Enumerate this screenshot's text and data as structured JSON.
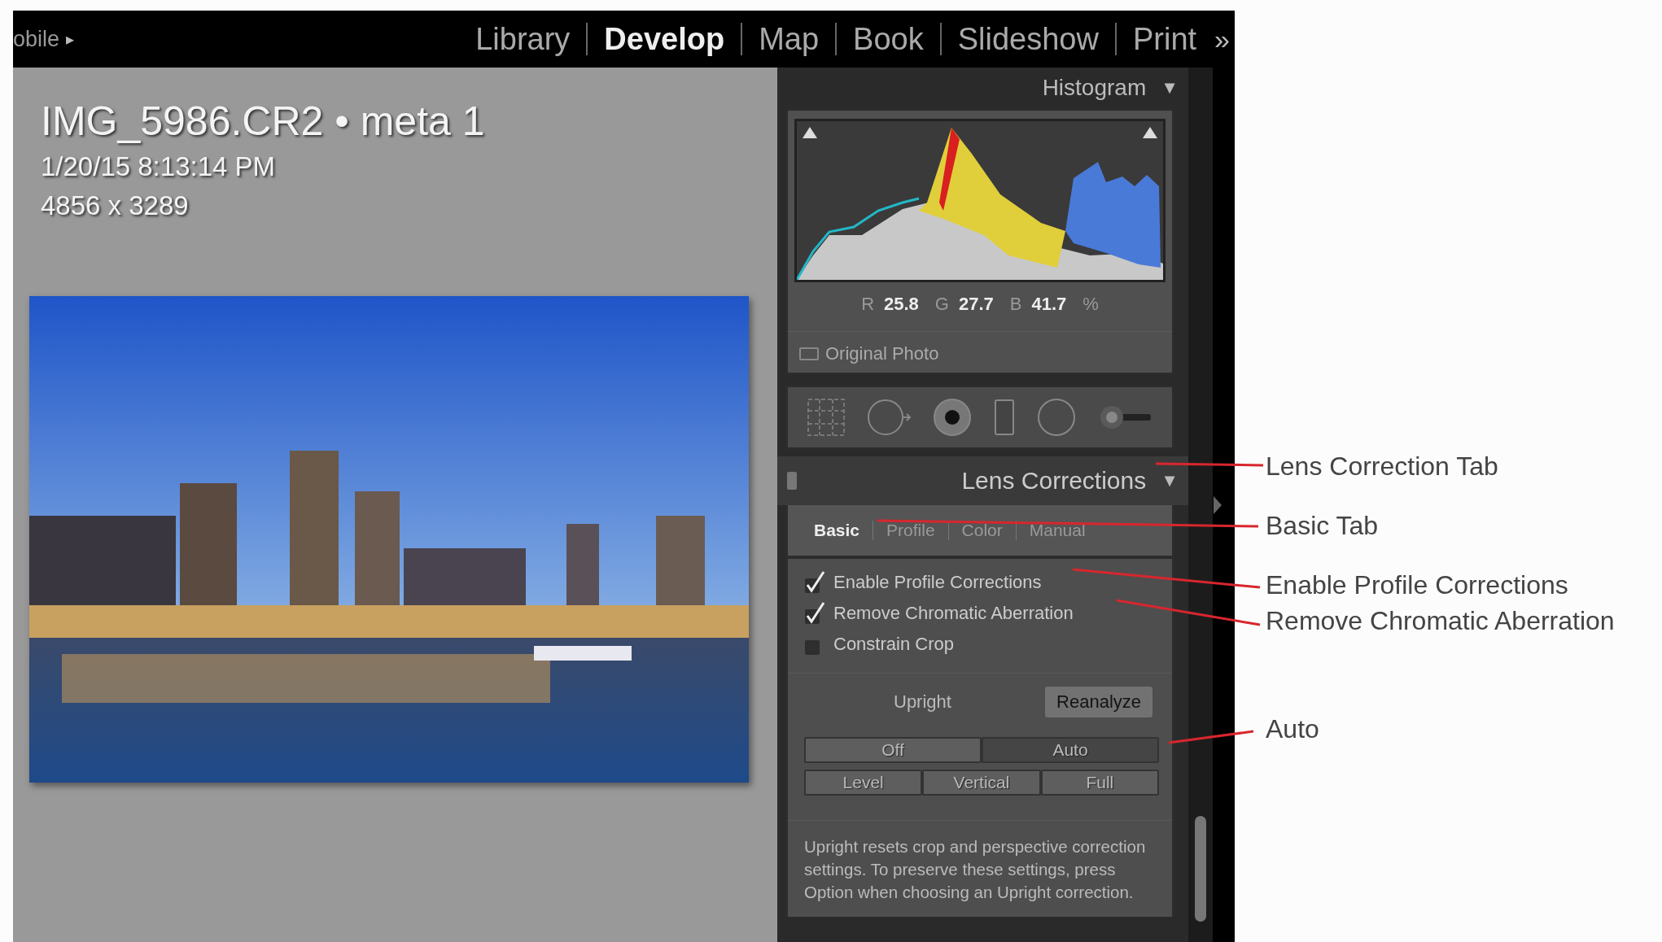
{
  "top_bar": {
    "module_picker": "obile",
    "module_picker_arrow": "▸",
    "modules": [
      {
        "label": "Library",
        "selected": false
      },
      {
        "label": "Develop",
        "selected": true
      },
      {
        "label": "Map",
        "selected": false
      },
      {
        "label": "Book",
        "selected": false
      },
      {
        "label": "Slideshow",
        "selected": false
      },
      {
        "label": "Print",
        "selected": false
      }
    ],
    "more": "»"
  },
  "image_info": {
    "title": "IMG_5986.CR2 • meta 1",
    "date": "1/20/15 8:13:14 PM",
    "dimensions": "4856 x 3289"
  },
  "histogram": {
    "title": "Histogram",
    "collapse": "▼",
    "readout": [
      {
        "channel": "R",
        "value": "25.8"
      },
      {
        "channel": "G",
        "value": "27.7"
      },
      {
        "channel": "B",
        "value": "41.7"
      }
    ],
    "unit": "%",
    "original_photo": {
      "label": "Original Photo",
      "checked": false
    }
  },
  "lens_corrections": {
    "title": "Lens Corrections",
    "collapse": "▼",
    "tabs": [
      {
        "label": "Basic",
        "selected": true
      },
      {
        "label": "Profile",
        "selected": false
      },
      {
        "label": "Color",
        "selected": false
      },
      {
        "label": "Manual",
        "selected": false
      }
    ],
    "options": [
      {
        "label": "Enable Profile Corrections",
        "checked": true
      },
      {
        "label": "Remove Chromatic Aberration",
        "checked": true
      },
      {
        "label": "Constrain Crop",
        "checked": false
      }
    ],
    "upright_label": "Upright",
    "reanalyze": {
      "label": "Reanalyze",
      "disabled": true
    },
    "upright_modes": [
      [
        {
          "label": "Off",
          "selected": false
        },
        {
          "label": "Auto",
          "selected": true
        }
      ],
      [
        {
          "label": "Level",
          "selected": false
        },
        {
          "label": "Vertical",
          "selected": false
        },
        {
          "label": "Full",
          "selected": false
        }
      ]
    ],
    "help": "Upright resets crop and perspective correction settings. To preserve these settings, press Option when choosing an Upright correction."
  },
  "annotations": [
    {
      "label": "Lens Correction Tab"
    },
    {
      "label": "Basic Tab"
    },
    {
      "label": "Enable Profile Corrections"
    },
    {
      "label": "Remove Chromatic Aberration"
    },
    {
      "label": "Auto"
    }
  ]
}
